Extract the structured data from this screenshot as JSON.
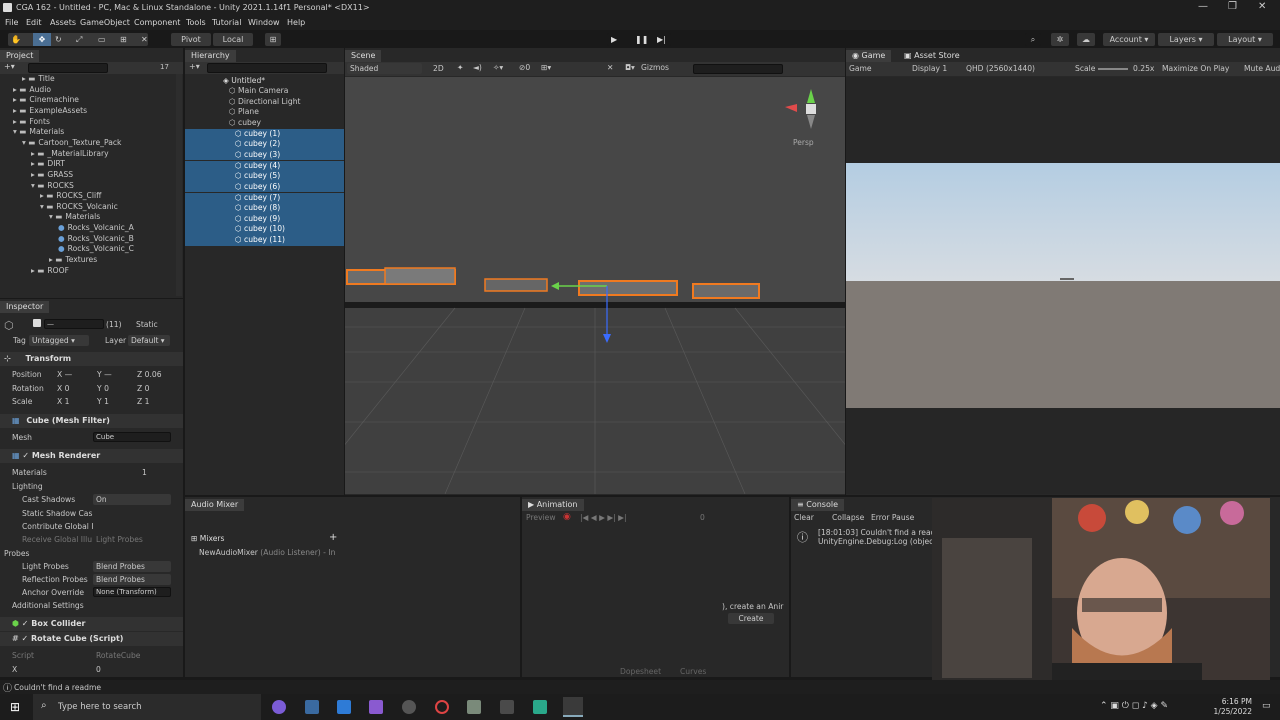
{
  "window": {
    "title": "CGA 162 - Untitled - PC, Mac & Linux Standalone - Unity 2021.1.14f1 Personal* <DX11>"
  },
  "menu": [
    "File",
    "Edit",
    "Assets",
    "GameObject",
    "Component",
    "Tools",
    "Tutorial",
    "Window",
    "Help"
  ],
  "toolbar": {
    "pivot": "Pivot",
    "local": "Local",
    "account": "Account",
    "layers": "Layers",
    "layout": "Layout"
  },
  "project": {
    "tab": "Project",
    "count": "17",
    "tree": [
      {
        "label": "Title",
        "depth": 2,
        "folder": true
      },
      {
        "label": "Audio",
        "depth": 1,
        "folder": true
      },
      {
        "label": "Cinemachine",
        "depth": 1,
        "folder": true
      },
      {
        "label": "ExampleAssets",
        "depth": 1,
        "folder": true
      },
      {
        "label": "Fonts",
        "depth": 1,
        "folder": true
      },
      {
        "label": "Materials",
        "depth": 1,
        "folder": true,
        "open": true
      },
      {
        "label": "Cartoon_Texture_Pack",
        "depth": 2,
        "folder": true,
        "open": true
      },
      {
        "label": "_MaterialLibrary",
        "depth": 3,
        "folder": true
      },
      {
        "label": "DIRT",
        "depth": 3,
        "folder": true
      },
      {
        "label": "GRASS",
        "depth": 3,
        "folder": true
      },
      {
        "label": "ROCKS",
        "depth": 3,
        "folder": true,
        "open": true
      },
      {
        "label": "ROCKS_Cliff",
        "depth": 4,
        "folder": true
      },
      {
        "label": "ROCKS_Volcanic",
        "depth": 4,
        "folder": true,
        "open": true
      },
      {
        "label": "Materials",
        "depth": 5,
        "folder": true,
        "open": true
      },
      {
        "label": "Rocks_Volcanic_A",
        "depth": 6,
        "folder": false
      },
      {
        "label": "Rocks_Volcanic_B",
        "depth": 6,
        "folder": false
      },
      {
        "label": "Rocks_Volcanic_C",
        "depth": 6,
        "folder": false
      },
      {
        "label": "Textures",
        "depth": 5,
        "folder": true
      },
      {
        "label": "ROOF",
        "depth": 3,
        "folder": true
      }
    ]
  },
  "hierarchy": {
    "tab": "Hierarchy",
    "scene": "Untitled*",
    "items": [
      "Main Camera",
      "Directional Light",
      "Plane",
      "cubey"
    ],
    "children": [
      "cubey (1)",
      "cubey (2)",
      "cubey (3)",
      "cubey (4)",
      "cubey (5)",
      "cubey (6)",
      "cubey (7)",
      "cubey (8)",
      "cubey (9)",
      "cubey (10)",
      "cubey (11)"
    ]
  },
  "scene": {
    "tab": "Scene",
    "shading": "Shaded",
    "mode": "2D",
    "gizmos": "Gizmos",
    "persp": "Persp"
  },
  "game": {
    "tab": "Game",
    "store_tab": "Asset Store",
    "display_mode": "Game",
    "display": "Display 1",
    "resolution": "QHD (2560x1440)",
    "scale_label": "Scale",
    "scale": "0.25x",
    "maximize": "Maximize On Play",
    "mute": "Mute Audio"
  },
  "inspector": {
    "tab": "Inspector",
    "count": "(11)",
    "static": "Static",
    "tag_label": "Tag",
    "tag": "Untagged",
    "layer_label": "Layer",
    "layer": "Default",
    "transform": {
      "title": "Transform",
      "position": {
        "label": "Position",
        "x": "—",
        "y": "—",
        "z": "0.06"
      },
      "rotation": {
        "label": "Rotation",
        "x": "0",
        "y": "0",
        "z": "0"
      },
      "scale": {
        "label": "Scale",
        "x": "1",
        "y": "1",
        "z": "1"
      }
    },
    "mesh_filter": {
      "title": "Cube (Mesh Filter)",
      "mesh_label": "Mesh",
      "mesh": "Cube"
    },
    "mesh_renderer": {
      "title": "Mesh Renderer",
      "materials_label": "Materials",
      "materials_count": "1",
      "lighting": "Lighting",
      "cast_shadows_label": "Cast Shadows",
      "cast_shadows": "On",
      "static_shadow": "Static Shadow Cas",
      "contribute_gi": "Contribute Global I",
      "receive_gi": "Receive Global Illu",
      "receive_gi_value": "Light Probes",
      "probes": "Probes",
      "light_probes_label": "Light Probes",
      "light_probes": "Blend Probes",
      "reflection_label": "Reflection Probes",
      "reflection": "Blend Probes",
      "anchor_label": "Anchor Override",
      "anchor": "None (Transform)",
      "additional": "Additional Settings"
    },
    "box_collider": {
      "title": "Box Collider"
    },
    "rotate_cube": {
      "title": "Rotate Cube (Script)",
      "script_label": "Script",
      "script": "RotateCube",
      "x_label": "X",
      "x": "0"
    }
  },
  "audio_mixer": {
    "tab": "Audio Mixer",
    "mixers": "Mixers",
    "item": "NewAudioMixer",
    "item_sub": "(Audio Listener) - In"
  },
  "animation": {
    "tab": "Animation",
    "preview": "Preview",
    "frame": "0",
    "hint": "), create an Anir",
    "create": "Create",
    "dopesheet": "Dopesheet",
    "curves": "Curves"
  },
  "console": {
    "tab": "Console",
    "clear": "Clear",
    "collapse": "Collapse",
    "error_pause": "Error Pause",
    "message1": "[18:01:03] Couldn't find a readme",
    "message2": "UnityEngine.Debug:Log (object"
  },
  "status": {
    "text": "Couldn't find a readme"
  },
  "taskbar": {
    "search": "Type here to search",
    "time": "6:16 PM",
    "date": "1/25/2022"
  },
  "colors": {
    "selection_orange": "#f07a20",
    "accent_blue": "#2c5d87",
    "gizmo_green": "#6ad24a",
    "gizmo_blue": "#3a6cff"
  }
}
